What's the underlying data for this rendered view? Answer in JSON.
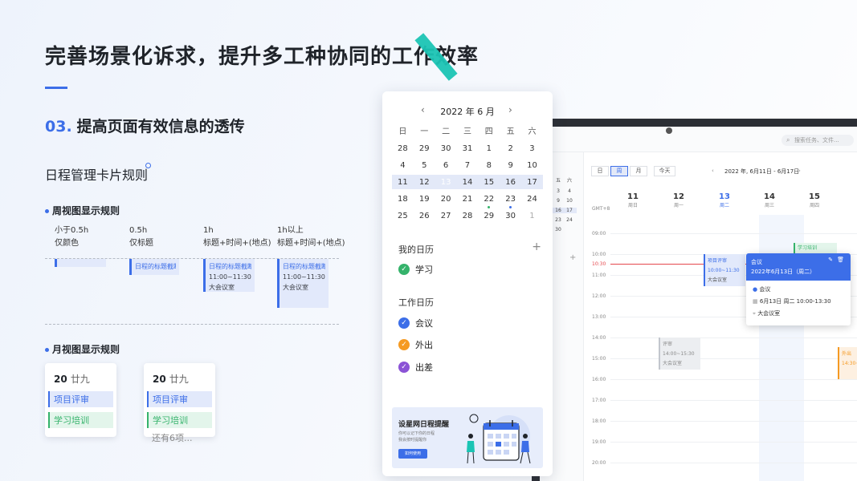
{
  "headline": "完善场景化诉求，提升多工种协同的工作效率",
  "section": {
    "num": "03.",
    "title": "提高页面有效信息的透传"
  },
  "rules_title": "日程管理卡片规则",
  "week_rules": {
    "title": "周视图显示规则",
    "columns": [
      {
        "duration": "小于0.5h",
        "rule": "仅颜色"
      },
      {
        "duration": "0.5h",
        "rule": "仅标题"
      },
      {
        "duration": "1h",
        "rule": "标题+时间+(地点)"
      },
      {
        "duration": "1h以上",
        "rule": "标题+时间+(地点)"
      }
    ],
    "event_title": "日程的标题截断...",
    "event_time": "11:00~11:30",
    "event_place": "大会议室"
  },
  "month_rules": {
    "title": "月视图显示规则",
    "cards": [
      {
        "day": "20",
        "lunar": "廿九",
        "events": [
          "项目评审",
          "学习培训"
        ],
        "more": ""
      },
      {
        "day": "20",
        "lunar": "廿九",
        "events": [
          "项目评审",
          "学习培训"
        ],
        "more": "还有6项..."
      }
    ]
  },
  "panel": {
    "month": "2022 年 6 月",
    "prev": "‹",
    "next": "›",
    "weekdays": [
      "日",
      "一",
      "二",
      "三",
      "四",
      "五",
      "六"
    ],
    "weeks": [
      [
        "28",
        "29",
        "30",
        "31",
        "1",
        "2",
        "3"
      ],
      [
        "4",
        "5",
        "6",
        "7",
        "8",
        "9",
        "10"
      ],
      [
        "11",
        "12",
        "13",
        "14",
        "15",
        "16",
        "17"
      ],
      [
        "18",
        "19",
        "20",
        "21",
        "22",
        "23",
        "24"
      ],
      [
        "25",
        "26",
        "27",
        "28",
        "29",
        "30",
        "1"
      ]
    ],
    "today": "13",
    "my_calendars": "我的日历",
    "add": "+",
    "my_items": [
      {
        "label": "学习",
        "color": "#35b36b"
      }
    ],
    "work_calendars": "工作日历",
    "work_items": [
      {
        "label": "会议",
        "color": "#3c6ee8"
      },
      {
        "label": "外出",
        "color": "#f59a23"
      },
      {
        "label": "出差",
        "color": "#8b53d6"
      }
    ],
    "banner": {
      "title": "设星网日程提醒",
      "sub1": "你可以记下你的日程",
      "sub2": "我会按时提醒你",
      "button": "如何使用"
    }
  },
  "app": {
    "search_placeholder": "搜索任务、文件...",
    "view_day": "日",
    "view_week": "周",
    "view_month": "月",
    "today_btn": "今天",
    "range": "2022 年, 6月11日 - 6月17日",
    "tz": "GMT+8",
    "days": [
      {
        "n": "11",
        "w": "周日"
      },
      {
        "n": "12",
        "w": "周一"
      },
      {
        "n": "13",
        "w": "周二"
      },
      {
        "n": "14",
        "w": "周三"
      },
      {
        "n": "15",
        "w": "周四"
      }
    ],
    "mini_cols": [
      "五",
      "六"
    ],
    "mini_rows": [
      [
        "3",
        "4"
      ],
      [
        "9",
        "10"
      ],
      [
        "16",
        "17"
      ],
      [
        "23",
        "24"
      ],
      [
        "30",
        ""
      ]
    ],
    "hours": [
      "09:00",
      "10:00",
      "10:30",
      "11:00",
      "12:00",
      "13:00",
      "14:00",
      "15:00",
      "16:00",
      "17:00",
      "18:00",
      "19:00",
      "20:00"
    ],
    "events": {
      "study": "学习培训",
      "review_title": "项目评审",
      "review_time": "10:00~11:30",
      "review_place": "大会议室",
      "grey_title": "评审",
      "grey_time": "14:00~15:30",
      "grey_place": "大会议室",
      "out_title": "外出",
      "out_time": "14:30~"
    },
    "popup": {
      "title": "会议",
      "date": "2022年6月13日（周二）",
      "type": "会议",
      "time": "6月13日 周二 10:00-13:30",
      "place": "大会议室"
    }
  }
}
